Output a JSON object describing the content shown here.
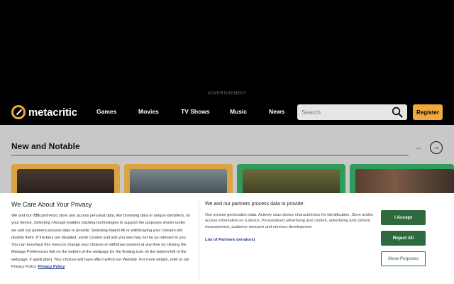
{
  "ad": {
    "label": "ADVERTISEMENT"
  },
  "header": {
    "logo_text": "metacritic",
    "nav": [
      "Games",
      "Movies",
      "TV Shows",
      "Music",
      "News"
    ],
    "search": {
      "placeholder": "Search"
    },
    "register_label": "Register"
  },
  "section": {
    "title": "New and Notable",
    "prev_arrow": "←",
    "next_arrow": "→",
    "cards": [
      {
        "border_color": "#d9a441"
      },
      {
        "border_color": "#d9a441"
      },
      {
        "border_color": "#2f9b5c"
      },
      {
        "border_color": "#2f9b5c"
      }
    ]
  },
  "consent": {
    "title": "We Care About Your Privacy",
    "body_prefix": "We and our ",
    "partner_count": "726",
    "body_main": " partner(s) store and access personal data, like browsing data or unique identifiers, on your device. Selecting I Accept enables tracking technologies to support the purposes shown under we and our partners process data to provide. Selecting Reject All or withdrawing your consent will disable them. If trackers are disabled, some content and ads you see may not be as relevant to you. You can resurface this menu to change your choices or withdraw consent at any time by clicking the Manage Preferences link on the bottom of the webpage [or the floating icon on the bottom-left of the webpage, if applicable]. Your choices will have effect within our Website. For more details, refer to our Privacy Policy.",
    "privacy_link": "Privacy Policy",
    "partners_title": "We and our partners process data to provide:",
    "partners_body": "Use precise geolocation data. Actively scan device characteristics for identification. Store and/or access information on a device. Personalised advertising and content, advertising and content measurement, audience research and services development.",
    "vendors_link": "List of Partners (vendors)",
    "accept_label": "I Accept",
    "reject_label": "Reject All",
    "show_label": "Show Purposes",
    "accent_color": "#2f6a3f"
  }
}
